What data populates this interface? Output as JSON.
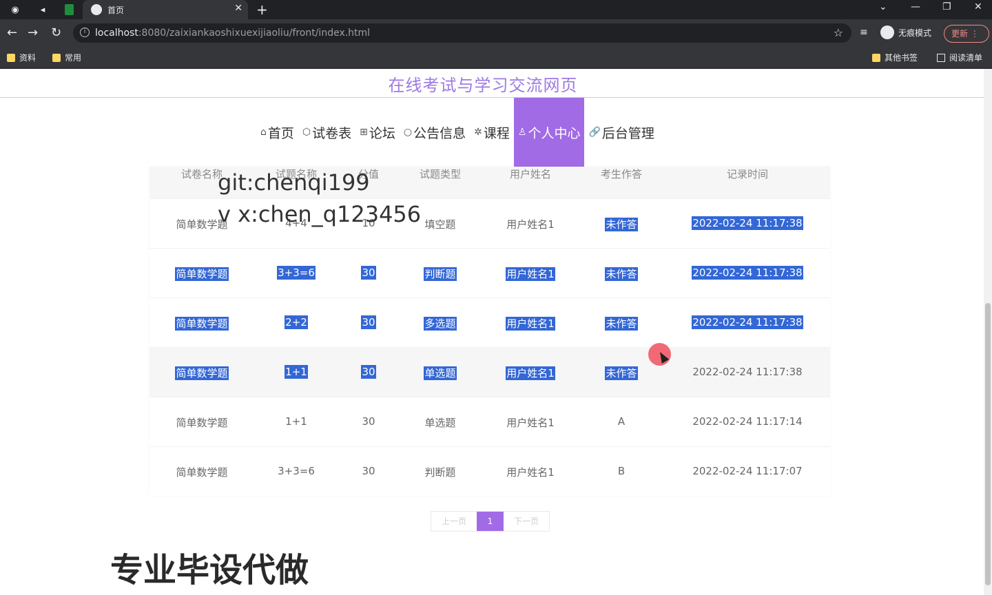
{
  "browser": {
    "tab_title": "首页",
    "url_host": "localhost",
    "url_rest": ":8080/zaixiankaoshixuexijiaoliu/front/index.html",
    "incognito_label": "无痕模式",
    "update_label": "更新",
    "bookmarks": [
      "资料",
      "常用"
    ],
    "bookmarks_right": [
      "其他书签",
      "阅读清单"
    ]
  },
  "site": {
    "title": "在线考试与学习交流网页",
    "nav": [
      {
        "label": "首页",
        "icon": "home-icon",
        "glyph": "⌂"
      },
      {
        "label": "试卷表",
        "icon": "cube-icon",
        "glyph": "⬡"
      },
      {
        "label": "论坛",
        "icon": "forum-icon",
        "glyph": "⊞"
      },
      {
        "label": "公告信息",
        "icon": "circle-icon",
        "glyph": "○"
      },
      {
        "label": "课程",
        "icon": "gear-icon",
        "glyph": "✲"
      },
      {
        "label": "个人中心",
        "icon": "user-icon",
        "glyph": "♙"
      },
      {
        "label": "后台管理",
        "icon": "link-icon",
        "glyph": "🔗"
      }
    ],
    "active_nav": "个人中心"
  },
  "table": {
    "headers": [
      "试卷名称",
      "试题名称",
      "分值",
      "试题类型",
      "用户姓名",
      "考生作答",
      "记录时间"
    ],
    "rows": [
      [
        "简单数学题",
        "4+4",
        "10",
        "填空题",
        "用户姓名1",
        "未作答",
        "2022-02-24 11:17:38"
      ],
      [
        "简单数学题",
        "3+3=6",
        "30",
        "判断题",
        "用户姓名1",
        "未作答",
        "2022-02-24 11:17:38"
      ],
      [
        "简单数学题",
        "2+2",
        "30",
        "多选题",
        "用户姓名1",
        "未作答",
        "2022-02-24 11:17:38"
      ],
      [
        "简单数学题",
        "1+1",
        "30",
        "单选题",
        "用户姓名1",
        "未作答",
        "2022-02-24 11:17:38"
      ],
      [
        "简单数学题",
        "1+1",
        "30",
        "单选题",
        "用户姓名1",
        "A",
        "2022-02-24 11:17:14"
      ],
      [
        "简单数学题",
        "3+3=6",
        "30",
        "判断题",
        "用户姓名1",
        "B",
        "2022-02-24 11:17:07"
      ]
    ]
  },
  "pager": {
    "prev": "上一页",
    "current": "1",
    "next": "下一页"
  },
  "overlay": {
    "wm1": "git:chenqi199",
    "wm2": "v x:chen_q123456",
    "promo": "专业毕设代做"
  },
  "colors": {
    "accent": "#a26be6",
    "title": "#9d79e3",
    "selection": "#3367d6"
  }
}
